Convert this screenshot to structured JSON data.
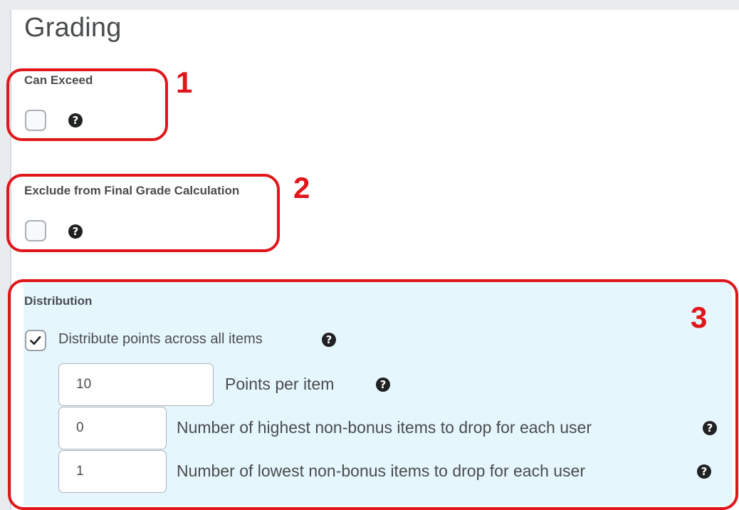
{
  "page": {
    "title": "Grading"
  },
  "can_exceed": {
    "label": "Can Exceed",
    "checked": false,
    "help_icon": "question-circle-icon"
  },
  "exclude_final": {
    "label": "Exclude from Final Grade Calculation",
    "checked": false,
    "help_icon": "question-circle-icon"
  },
  "distribution": {
    "label": "Distribution",
    "distribute_checkbox": {
      "label": "Distribute points across all items",
      "checked": true
    },
    "points_per_item": {
      "value": "10",
      "label": "Points per item"
    },
    "drop_highest": {
      "value": "0",
      "label": "Number of highest non-bonus items to drop for each user"
    },
    "drop_lowest": {
      "value": "1",
      "label": "Number of lowest non-bonus items to drop for each user"
    }
  },
  "annotations": {
    "one": "1",
    "two": "2",
    "three": "3",
    "color": "#e0161b"
  },
  "colors": {
    "highlight_bg": "#e6f6fd",
    "text": "#494c4e"
  }
}
